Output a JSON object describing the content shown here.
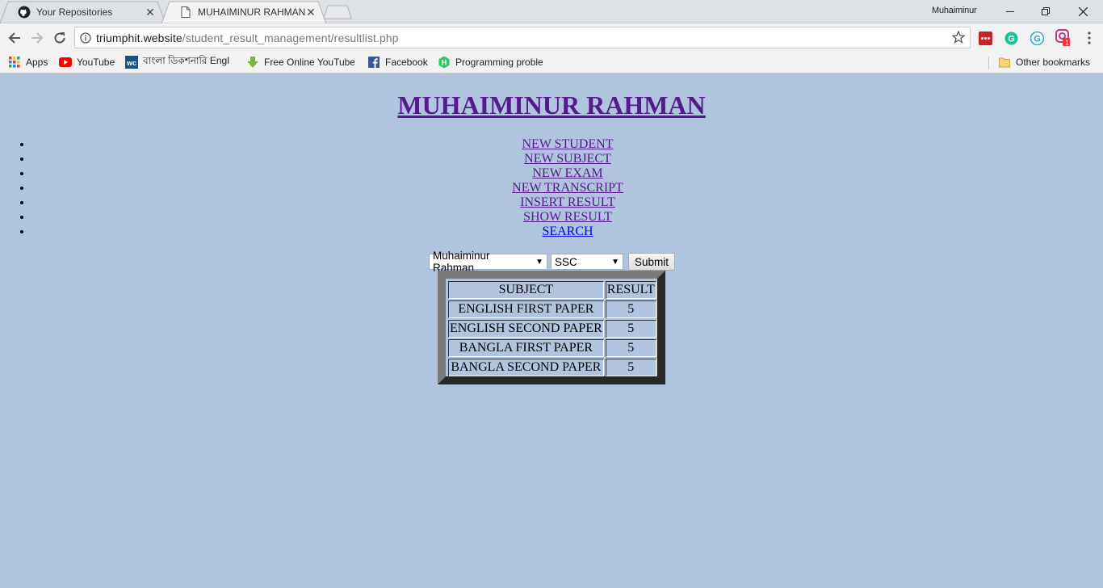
{
  "browser": {
    "tabs": [
      {
        "title": "Your Repositories",
        "icon": "github-icon",
        "active": false
      },
      {
        "title": "MUHAIMINUR RAHMAN",
        "icon": "page-icon",
        "active": true
      }
    ],
    "profile_name": "Muhaiminur",
    "url_host": "triumphit.website",
    "url_path": "/student_result_management/resultlist.php",
    "extension_badge": "1",
    "bookmarks": [
      {
        "label": "Apps",
        "icon": "apps-grid-icon"
      },
      {
        "label": "YouTube",
        "icon": "youtube-icon"
      },
      {
        "label": "বাংলা ডিকশনারি Engl",
        "icon": "dictionary-icon"
      },
      {
        "label": "Free Online YouTube",
        "icon": "download-arrow-icon"
      },
      {
        "label": "Facebook",
        "icon": "facebook-icon"
      },
      {
        "label": "Programming proble",
        "icon": "hackerrank-icon"
      }
    ],
    "other_bookmarks": "Other bookmarks"
  },
  "page": {
    "title": "MUHAIMINUR RAHMAN",
    "menu": [
      {
        "label": "NEW STUDENT"
      },
      {
        "label": "NEW SUBJECT"
      },
      {
        "label": "NEW EXAM"
      },
      {
        "label": "NEW TRANSCRIPT"
      },
      {
        "label": "INSERT RESULT"
      },
      {
        "label": "SHOW RESULT"
      },
      {
        "label": "SEARCH"
      }
    ],
    "filter": {
      "student_selected": "Muhaiminur Rahman",
      "exam_selected": "SSC",
      "submit_label": "Submit"
    },
    "results": {
      "headers": [
        "SUBJECT",
        "RESULT"
      ],
      "rows": [
        [
          "ENGLISH FIRST PAPER",
          "5"
        ],
        [
          "ENGLISH SECOND PAPER",
          "5"
        ],
        [
          "BANGLA FIRST PAPER",
          "5"
        ],
        [
          "BANGLA SECOND PAPER",
          "5"
        ]
      ]
    }
  }
}
